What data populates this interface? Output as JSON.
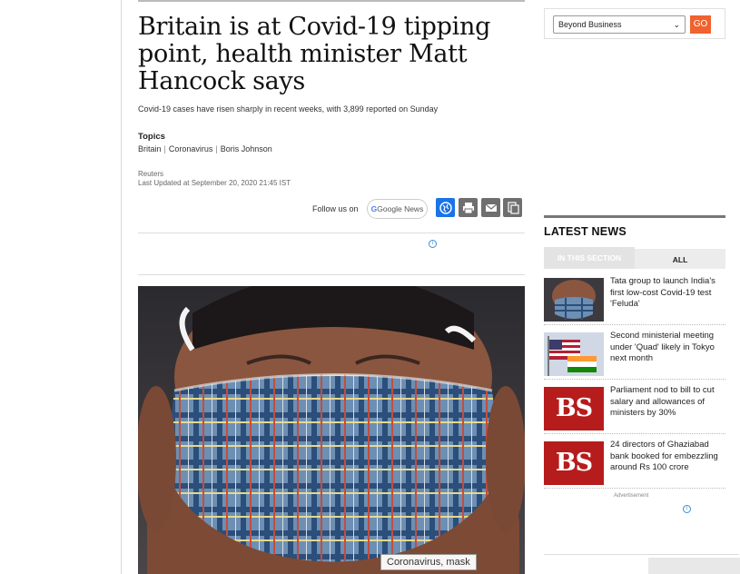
{
  "article": {
    "headline": "Britain is at Covid-19 tipping point, health minister Matt Hancock says",
    "subheadline": "Covid-19 cases have risen sharply in recent weeks, with 3,899 reported on Sunday",
    "topics_label": "Topics",
    "topics": [
      "Britain",
      "Coronavirus",
      "Boris Johnson"
    ],
    "source": "Reuters",
    "updated": "Last Updated at September 20, 2020 21:45 IST",
    "follow_label": "Follow us on",
    "google_news_label": "Google News",
    "image_caption": "Coronavirus, mask",
    "icons": [
      "globe-icon",
      "print-icon",
      "email-icon",
      "copy-icon"
    ]
  },
  "sidebar": {
    "select_value": "Beyond Business",
    "go_label": "GO",
    "latest_title": "LATEST NEWS",
    "tabs": [
      {
        "label": "IN THIS SECTION",
        "active": false
      },
      {
        "label": "ALL",
        "active": true
      }
    ],
    "news": [
      {
        "title": "Tata group to launch India's first low-cost Covid-19 test 'Feluda'",
        "thumb": "mask-photo"
      },
      {
        "title": "Second ministerial meeting under 'Quad' likely in Tokyo next month",
        "thumb": "flags-photo"
      },
      {
        "title": "Parliament nod to bill to cut salary and allowances of ministers by 30%",
        "thumb": "BS"
      },
      {
        "title": "24 directors of Ghaziabad bank booked for embezzling around Rs 100 crore",
        "thumb": "BS"
      }
    ],
    "advertisement_label": "Advertisement"
  },
  "colors": {
    "go_button": "#f0622e",
    "bs_red": "#b71c1c",
    "share_blue": "#1a73e8"
  }
}
